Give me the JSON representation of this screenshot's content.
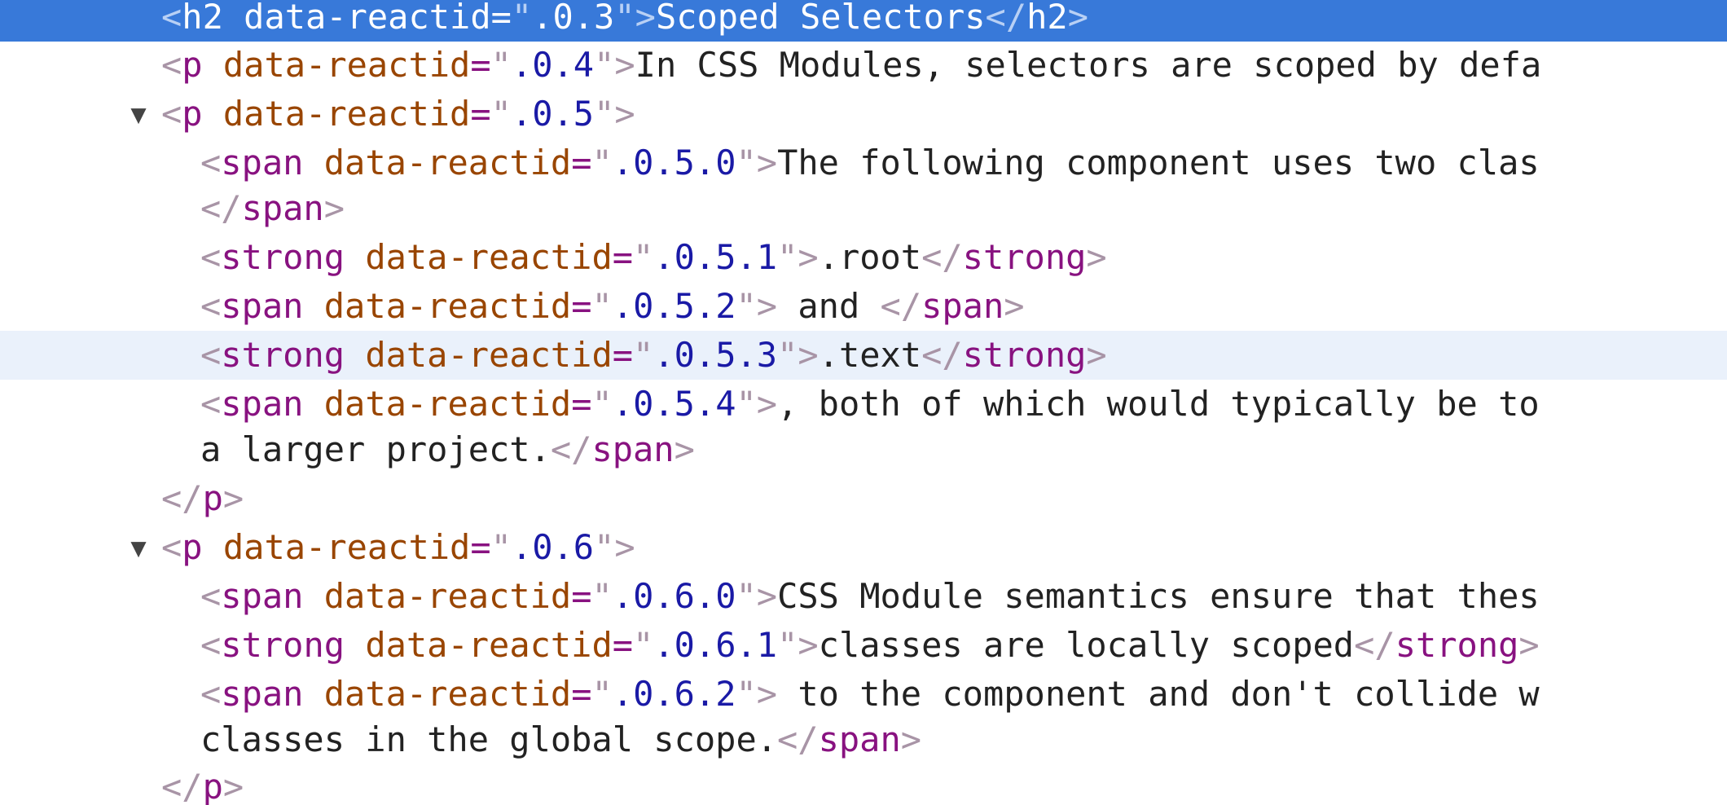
{
  "inspector": {
    "triangle_open": "▼",
    "punct": {
      "lt": "<",
      "lt_close": "</",
      "gt": ">",
      "eq": "=",
      "quote": "\""
    },
    "attribute_name": "data-reactid",
    "rows": [
      {
        "kind": "open-close",
        "tag": "h2",
        "attr_value": ".0.3",
        "text": "Scoped Selectors",
        "selected": true
      },
      {
        "kind": "open-close-clipped",
        "tag": "p",
        "attr_value": ".0.4",
        "text": "In CSS Modules, selectors are scoped by defa"
      },
      {
        "kind": "open",
        "tag": "p",
        "attr_value": ".0.5",
        "expanded": true
      },
      {
        "kind": "open-clipped",
        "tag": "span",
        "attr_value": ".0.5.0",
        "text": "The following component uses two clas"
      },
      {
        "kind": "close",
        "tag": "span"
      },
      {
        "kind": "open-close",
        "tag": "strong",
        "attr_value": ".0.5.1",
        "text": ".root"
      },
      {
        "kind": "open-close",
        "tag": "span",
        "attr_value": ".0.5.2",
        "text": " and "
      },
      {
        "kind": "open-close",
        "tag": "strong",
        "attr_value": ".0.5.3",
        "text": ".text",
        "hovered": true
      },
      {
        "kind": "open-clipped",
        "tag": "span",
        "attr_value": ".0.5.4",
        "text": ", both of which would typically be to"
      },
      {
        "kind": "text-close",
        "tag": "span",
        "text": "a larger project."
      },
      {
        "kind": "close",
        "tag": "p"
      },
      {
        "kind": "open",
        "tag": "p",
        "attr_value": ".0.6",
        "expanded": true
      },
      {
        "kind": "open-clipped",
        "tag": "span",
        "attr_value": ".0.6.0",
        "text": "CSS Module semantics ensure that thes"
      },
      {
        "kind": "open-close",
        "tag": "strong",
        "attr_value": ".0.6.1",
        "text": "classes are locally scoped"
      },
      {
        "kind": "open-clipped",
        "tag": "span",
        "attr_value": ".0.6.2",
        "text": " to the component and don't collide w"
      },
      {
        "kind": "text-close",
        "tag": "span",
        "text": "classes in the global scope."
      },
      {
        "kind": "close",
        "tag": "p"
      }
    ]
  }
}
